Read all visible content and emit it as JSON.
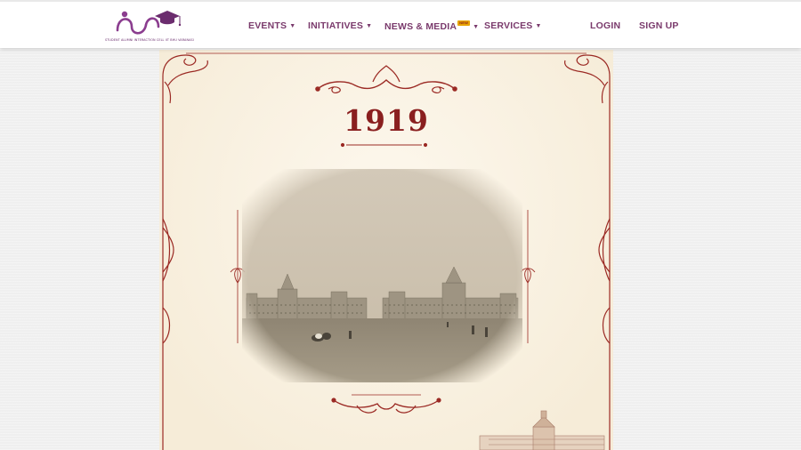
{
  "logo": {
    "icon": "alumni-graduation-cap-logo",
    "tagline": "STUDENT ALUMNI INTERACTION CELL IIT BHU VARANASI",
    "brand_color": "#8b3d8f"
  },
  "nav": {
    "items": [
      {
        "label": "EVENTS",
        "has_dropdown": true
      },
      {
        "label": "INITIATIVES",
        "has_dropdown": true
      },
      {
        "label": "NEWS & MEDIA",
        "has_dropdown": true,
        "badge": "NEW"
      },
      {
        "label": "SERVICES",
        "has_dropdown": true
      }
    ],
    "login": "LOGIN",
    "signup": "SIGN UP",
    "color": "#7a3a6c"
  },
  "card": {
    "year": "1919",
    "accent_color": "#8a1f1f"
  }
}
